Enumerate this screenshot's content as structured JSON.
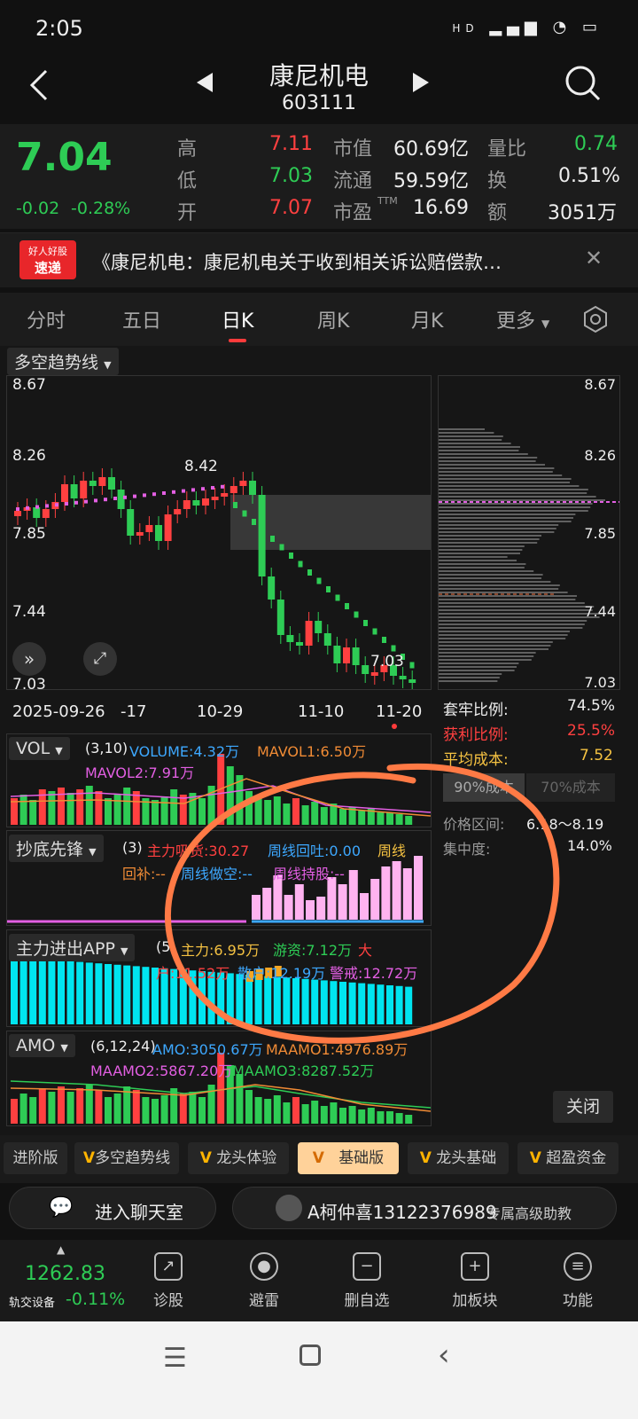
{
  "status": {
    "time": "2:05",
    "network": "HD"
  },
  "header": {
    "name": "康尼机电",
    "code": "603111"
  },
  "quote": {
    "price": "7.04",
    "change": "-0.02",
    "change_pct": "-0.28%",
    "high_label": "高",
    "high": "7.11",
    "low_label": "低",
    "low": "7.03",
    "open_label": "开",
    "open": "7.07",
    "mcap_label": "市值",
    "mcap": "60.69亿",
    "float_label": "流通",
    "float": "59.59亿",
    "pe_label": "市盈",
    "pe_sup": "TTM",
    "pe": "16.69",
    "vr_label": "量比",
    "vr": "0.74",
    "turn_label": "换",
    "turn": "0.51%",
    "amt_label": "额",
    "amt": "3051万"
  },
  "news": {
    "badge_top": "好人好股",
    "badge_bottom": "速递",
    "text": "《康尼机电：康尼机电关于收到相关诉讼赔偿款…"
  },
  "tabs": [
    "分时",
    "五日",
    "日K",
    "周K",
    "月K",
    "更多"
  ],
  "active_tab": "日K",
  "main_chart": {
    "indicator": "多空趋势线",
    "y_labels": [
      "8.67",
      "8.26",
      "7.85",
      "7.44",
      "7.03"
    ],
    "x_labels": [
      "2025-09-26",
      "-17",
      "10-29",
      "11-10",
      "11-20"
    ],
    "annot_high": "8.42",
    "annot_low": "7.03"
  },
  "cost": {
    "y_labels": [
      "8.67",
      "8.26",
      "7.85",
      "7.44",
      "7.03"
    ],
    "trap_label": "套牢比例:",
    "trap": "74.5%",
    "profit_label": "获利比例:",
    "profit": "25.5%",
    "avg_label": "平均成本:",
    "avg": "7.52",
    "tab90": "90%成本",
    "tab70": "70%成本",
    "range_label": "价格区间:",
    "range": "6.18～8.19",
    "conc_label": "集中度:",
    "conc": "14.0%",
    "close": "关闭"
  },
  "vol": {
    "name": "VOL",
    "params": "(3,10)",
    "v1": "VOLUME:4.32万",
    "v2": "MAVOL1:6.50万",
    "v3": "MAVOL2:7.91万"
  },
  "cdxf": {
    "name": "抄底先锋",
    "params": "(3)",
    "a": "主力吸货:30.27",
    "b": "周线回吐:0.00",
    "c": "周线",
    "d": "回补:--",
    "e": "周线做空:--",
    "f": "周线持股:--"
  },
  "zljc": {
    "name": "主力进出APP",
    "params": "(5)",
    "a": "主力:6.95万",
    "b": "游资:7.12万",
    "c": "大",
    "d": "户:11.52万",
    "e": "散户:12.19万",
    "f": "警戒:12.72万"
  },
  "amo": {
    "name": "AMO",
    "params": "(6,12,24)",
    "a": "AMO:3050.67万",
    "b": "MAAMO1:4976.89万",
    "c": "MAAMO2:5867.20万",
    "d": "MAAMO3:8287.52万"
  },
  "indicator_tabs": [
    "进阶版",
    "多空趋势线",
    "龙头体验",
    "基础版",
    "龙头基础",
    "超盈资金"
  ],
  "indicator_selected": "基础版",
  "chat": {
    "room": "进入聊天室",
    "advisor": "A柯仲喜13122376989",
    "advisor_tag": "专属高级助教"
  },
  "bottom": {
    "index_value": "1262.83",
    "index_name": "轨交设备",
    "index_pct": "-0.11%",
    "tools": [
      "诊股",
      "避雷",
      "删自选",
      "加板块",
      "功能"
    ]
  },
  "colors": {
    "up": "#ff4040",
    "down": "#2ecc55",
    "accent": "#ff3b3b",
    "highlight": "#ff7a45"
  }
}
